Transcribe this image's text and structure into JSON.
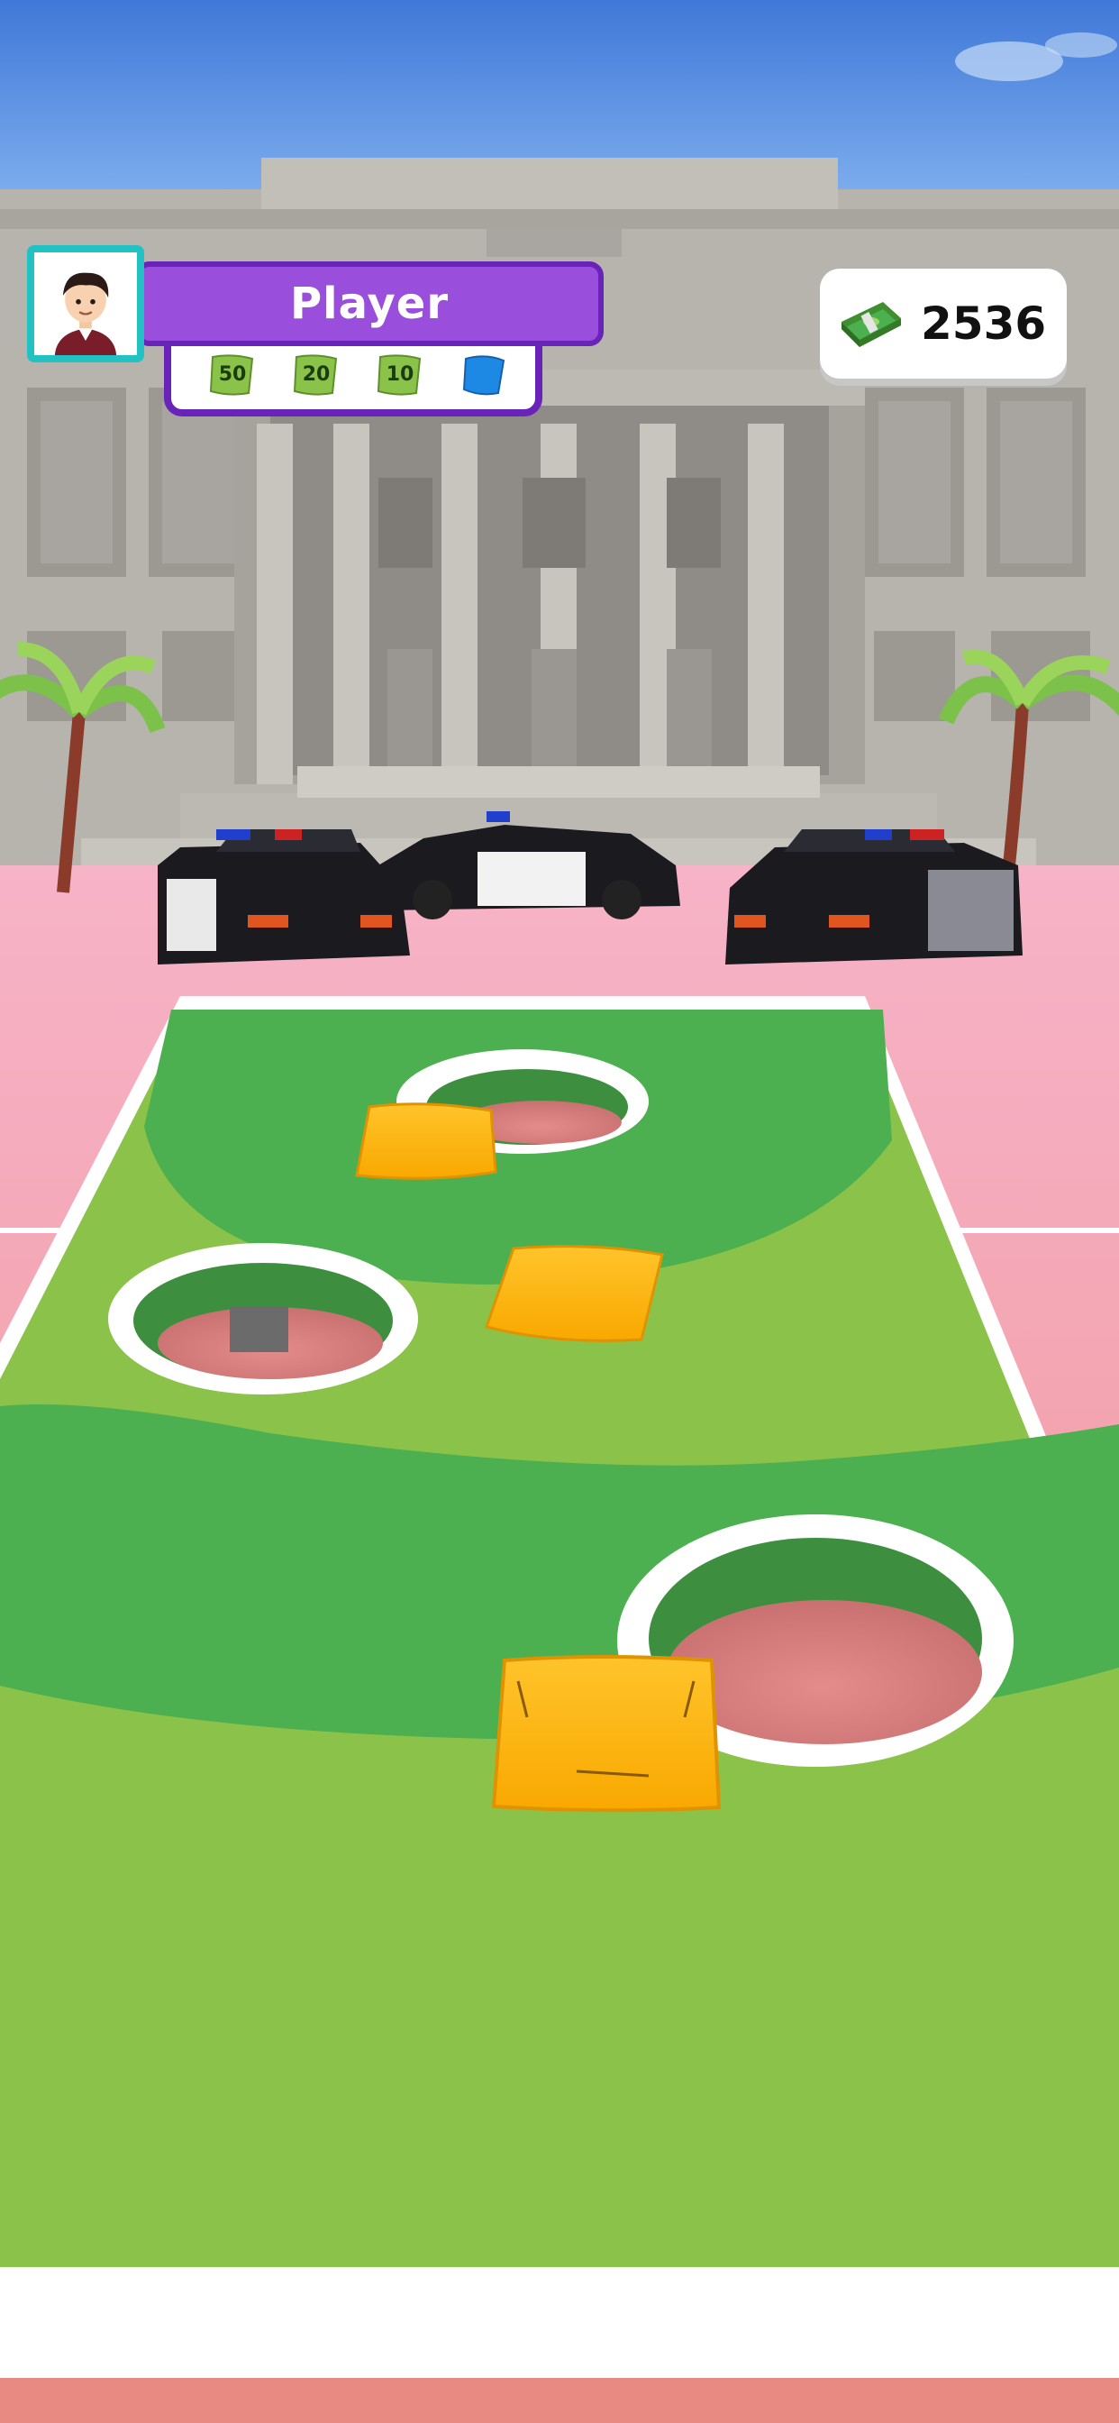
{
  "player": {
    "name": "Player",
    "avatar_icon": "player-avatar-icon",
    "frame_color": "#22c1c3",
    "bar_color": "#9a4fdc"
  },
  "bag_slots": [
    {
      "label": "50",
      "color": "#8bc34a",
      "icon": "bag-icon"
    },
    {
      "label": "20",
      "color": "#8bc34a",
      "icon": "bag-icon"
    },
    {
      "label": "10",
      "color": "#8bc34a",
      "icon": "bag-icon"
    },
    {
      "label": "",
      "color": "#1e88e5",
      "icon": "bag-icon"
    }
  ],
  "money": {
    "amount": "2536",
    "icon": "cash-stack-icon"
  },
  "scene": {
    "sky_color": "#4a86e0",
    "building_color": "#b9b6b1",
    "ground_color": "#f2a3b5",
    "field_light": "#8bc34a",
    "field_dark": "#4caf50",
    "beanbag_color": "#ffb81c",
    "hole_count": 3,
    "beanbag_count": 3,
    "police_car_count": 3
  }
}
